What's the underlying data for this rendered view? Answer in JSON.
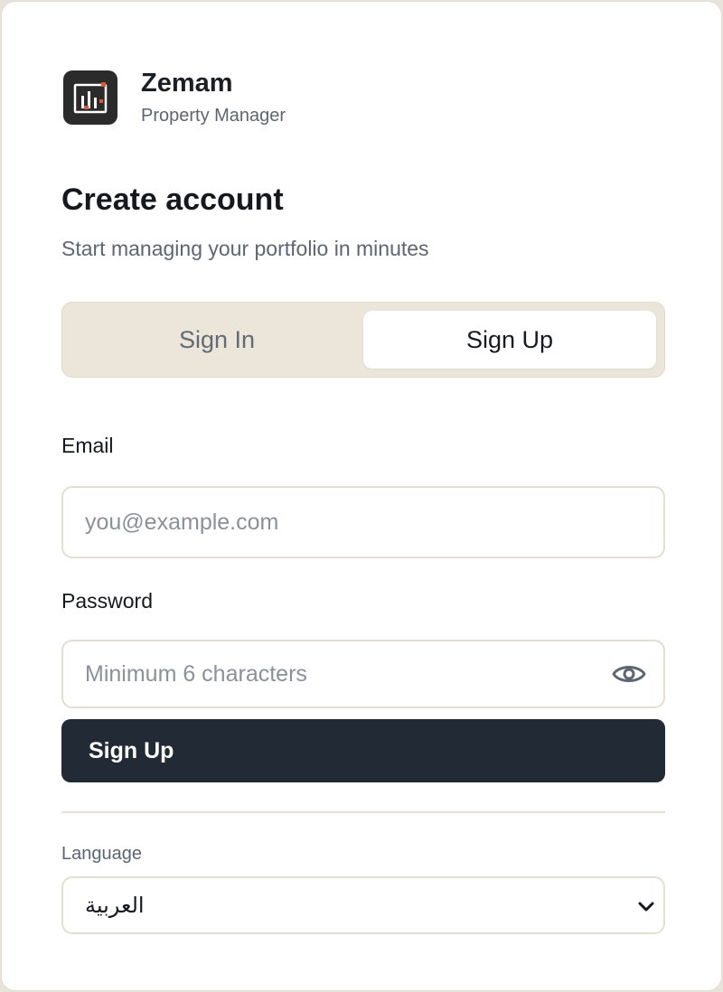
{
  "brand": {
    "name": "Zemam",
    "subtitle": "Property Manager"
  },
  "heading": {
    "title": "Create account",
    "subtitle": "Start managing your portfolio in minutes"
  },
  "tabs": [
    {
      "label": "Sign In",
      "active": false
    },
    {
      "label": "Sign Up",
      "active": true
    }
  ],
  "form": {
    "email_label": "Email",
    "email_placeholder": "you@example.com",
    "email_value": "",
    "password_label": "Password",
    "password_placeholder": "Minimum 6 characters",
    "password_value": "",
    "submit_label": "Sign Up"
  },
  "language": {
    "label": "Language",
    "selected": "العربية"
  },
  "icons": {
    "logo": "building-chart-icon",
    "password_toggle": "eye-icon",
    "select_caret": "chevron-down-icon"
  },
  "colors": {
    "primary_button": "#222b35",
    "segment_bg": "#ebe5da",
    "accent": "#e0563a",
    "page_bg": "#e8e4dc"
  }
}
